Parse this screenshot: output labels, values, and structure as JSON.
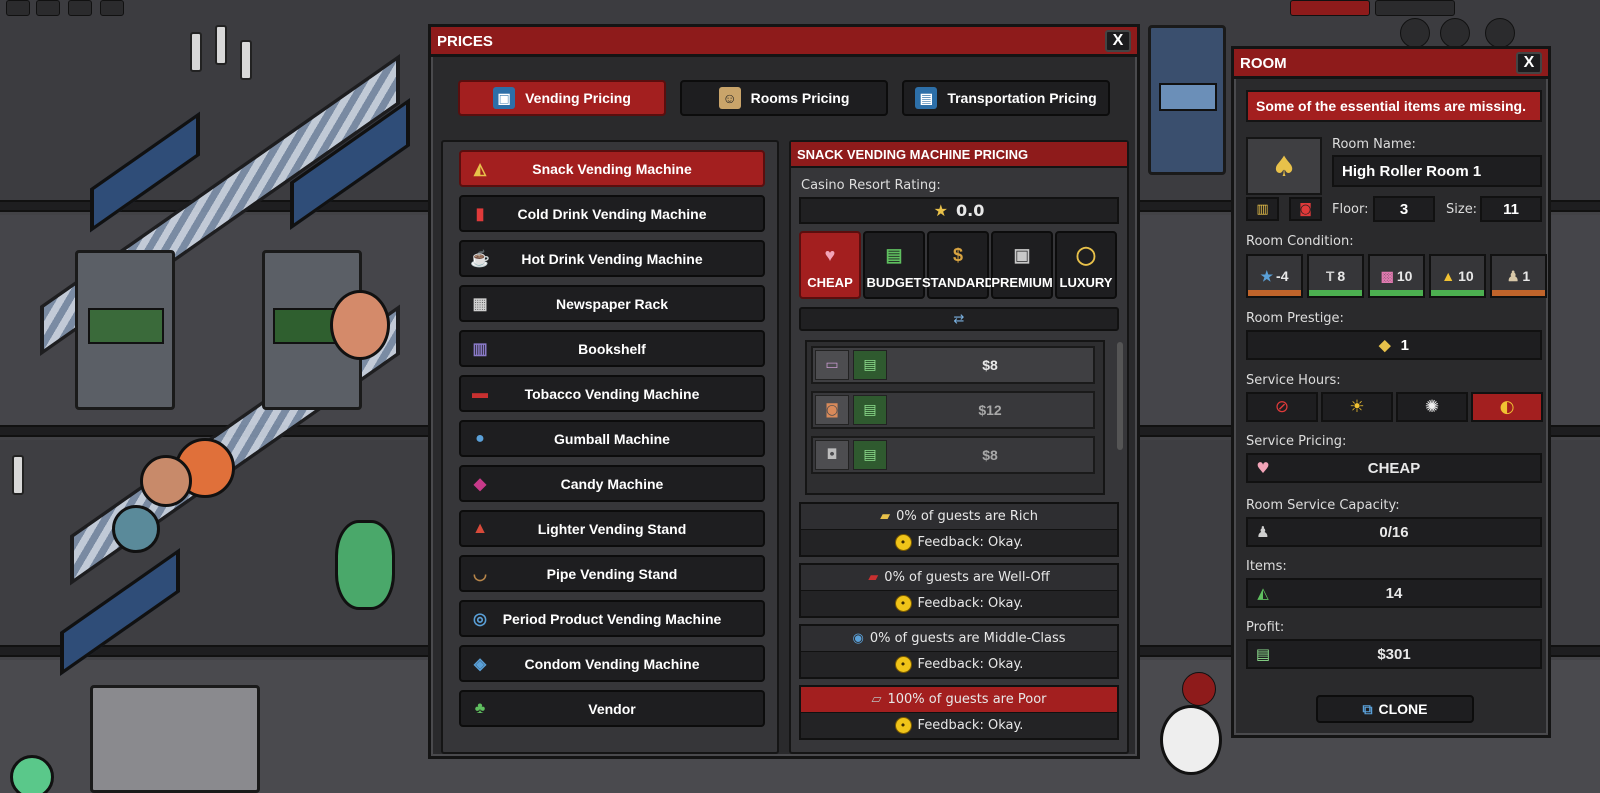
{
  "prices": {
    "title": "PRICES",
    "close": "X",
    "tabs": [
      {
        "label": "Vending Pricing",
        "icon": "vending-icon",
        "glyph": "▣"
      },
      {
        "label": "Rooms Pricing",
        "icon": "bellhop-icon",
        "glyph": "☺"
      },
      {
        "label": "Transportation Pricing",
        "icon": "elevator-icon",
        "glyph": "▤"
      }
    ],
    "machines": [
      {
        "label": "Snack Vending Machine",
        "icon": "snack-icon",
        "glyph": "◭"
      },
      {
        "label": "Cold Drink Vending Machine",
        "icon": "cold-drink-icon",
        "glyph": "▮"
      },
      {
        "label": "Hot Drink Vending Machine",
        "icon": "hot-drink-icon",
        "glyph": "☕"
      },
      {
        "label": "Newspaper Rack",
        "icon": "newspaper-icon",
        "glyph": "▦"
      },
      {
        "label": "Bookshelf",
        "icon": "bookshelf-icon",
        "glyph": "▥"
      },
      {
        "label": "Tobacco Vending Machine",
        "icon": "tobacco-icon",
        "glyph": "▬"
      },
      {
        "label": "Gumball Machine",
        "icon": "gumball-icon",
        "glyph": "●"
      },
      {
        "label": "Candy Machine",
        "icon": "candy-icon",
        "glyph": "◆"
      },
      {
        "label": "Lighter Vending Stand",
        "icon": "lighter-icon",
        "glyph": "▲"
      },
      {
        "label": "Pipe Vending Stand",
        "icon": "pipe-icon",
        "glyph": "◡"
      },
      {
        "label": "Period Product Vending Machine",
        "icon": "period-product-icon",
        "glyph": "◎"
      },
      {
        "label": "Condom Vending Machine",
        "icon": "condom-icon",
        "glyph": "◈"
      },
      {
        "label": "Vendor",
        "icon": "vendor-icon",
        "glyph": "♣"
      }
    ],
    "detail": {
      "title": "SNACK VENDING MACHINE PRICING",
      "rating_label": "Casino Resort Rating:",
      "rating_value": "0.0",
      "tiers": [
        {
          "label": "CHEAP",
          "icon": "piggy-bank-icon",
          "glyph": "♥",
          "color": "#f2a4b8"
        },
        {
          "label": "BUDGET",
          "icon": "cash-stack-icon",
          "glyph": "▤",
          "color": "#5fbf5f"
        },
        {
          "label": "STANDARD",
          "icon": "money-bag-icon",
          "glyph": "$",
          "color": "#d9a441"
        },
        {
          "label": "PREMIUM",
          "icon": "safe-icon",
          "glyph": "▣",
          "color": "#c9c9c9"
        },
        {
          "label": "LUXURY",
          "icon": "diamond-ring-icon",
          "glyph": "◯",
          "color": "#e8c14a"
        }
      ],
      "items": [
        {
          "price": "$8",
          "icon": "candy-bag-icon",
          "glyph": "▭"
        },
        {
          "price": "$12",
          "icon": "chips-icon",
          "glyph": "◙"
        },
        {
          "price": "$8",
          "icon": "cookie-jar-icon",
          "glyph": "◘"
        }
      ],
      "guests": [
        {
          "text": "0% of guests are Rich",
          "feedback": "Feedback: Okay.",
          "icon": "rich-icon",
          "glyph": "▰"
        },
        {
          "text": "0% of guests are Well-Off",
          "feedback": "Feedback: Okay.",
          "icon": "well-off-icon",
          "glyph": "▰"
        },
        {
          "text": "0% of guests are Middle-Class",
          "feedback": "Feedback: Okay.",
          "icon": "middle-class-icon",
          "glyph": "◉"
        },
        {
          "text": "100% of guests are Poor",
          "feedback": "Feedback: Okay.",
          "icon": "poor-icon",
          "glyph": "▱"
        }
      ]
    }
  },
  "room": {
    "title": "ROOM",
    "close": "X",
    "warning": "Some of the essential items are missing.",
    "name_label": "Room Name:",
    "name": "High Roller Room 1",
    "floor_label": "Floor:",
    "floor": "3",
    "size_label": "Size:",
    "size": "11",
    "condition_label": "Room Condition:",
    "conditions": [
      {
        "value": "-4",
        "icon": "police-badge-icon",
        "glyph": "★",
        "bar": "#c0642b"
      },
      {
        "value": "8",
        "icon": "hammer-icon",
        "glyph": "T",
        "bar": "#4caf50"
      },
      {
        "value": "10",
        "icon": "cleaning-icon",
        "glyph": "▩",
        "bar": "#4caf50"
      },
      {
        "value": "10",
        "icon": "lamp-icon",
        "glyph": "▲",
        "bar": "#4caf50"
      },
      {
        "value": "1",
        "icon": "staff-icon",
        "glyph": "♟",
        "bar": "#c0642b"
      }
    ],
    "prestige_label": "Room Prestige:",
    "prestige": "1",
    "hours_label": "Service Hours:",
    "hours": [
      {
        "icon": "no-service-icon",
        "glyph": "⊘",
        "selected": false,
        "color": "#e03a3a"
      },
      {
        "icon": "day-icon",
        "glyph": "☀",
        "selected": false,
        "color": "#f1c232"
      },
      {
        "icon": "night-icon",
        "glyph": "✺",
        "selected": false,
        "color": "#eeeeee"
      },
      {
        "icon": "day-night-icon",
        "glyph": "◐",
        "selected": true,
        "color": "#f1c232"
      }
    ],
    "pricing_label": "Service Pricing:",
    "pricing": "CHEAP",
    "capacity_label": "Room Service Capacity:",
    "capacity": "0/16",
    "items_label": "Items:",
    "items": "14",
    "profit_label": "Profit:",
    "profit": "$301",
    "clone": "CLONE"
  }
}
